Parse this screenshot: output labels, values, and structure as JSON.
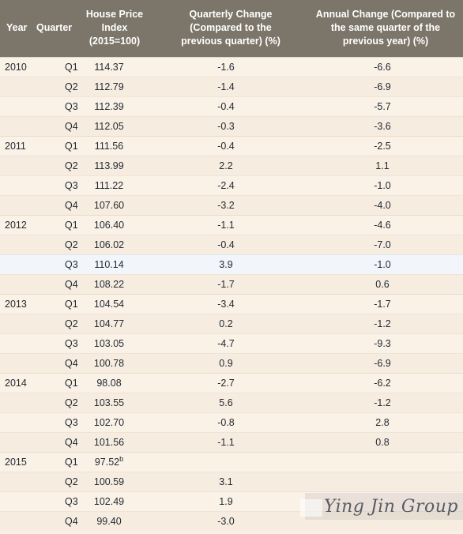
{
  "table": {
    "columns": [
      {
        "key": "year",
        "label": "Year"
      },
      {
        "key": "quarter",
        "label": "Quarter"
      },
      {
        "key": "index",
        "label": "House Price Index (2015=100)",
        "label_lines": [
          "House Price",
          "Index",
          "(2015=100)"
        ]
      },
      {
        "key": "qchg",
        "label": "Quarterly Change (Compared to the previous quarter) (%)",
        "label_lines": [
          "Quarterly Change",
          "(Compared to the",
          "previous quarter) (%)"
        ]
      },
      {
        "key": "achg",
        "label": "Annual Change (Compared to the same quarter of the previous year) (%)",
        "label_lines": [
          "Annual Change (Compared to",
          "the same quarter of the",
          "previous year) (%)"
        ]
      }
    ],
    "rows": [
      {
        "year": "2010",
        "quarter": "Q1",
        "index": "114.37",
        "qchg": "-1.6",
        "achg": "-6.6",
        "year_start": true,
        "highlight": false
      },
      {
        "year": "",
        "quarter": "Q2",
        "index": "112.79",
        "qchg": "-1.4",
        "achg": "-6.9",
        "year_start": false,
        "highlight": false
      },
      {
        "year": "",
        "quarter": "Q3",
        "index": "112.39",
        "qchg": "-0.4",
        "achg": "-5.7",
        "year_start": false,
        "highlight": false
      },
      {
        "year": "",
        "quarter": "Q4",
        "index": "112.05",
        "qchg": "-0.3",
        "achg": "-3.6",
        "year_start": false,
        "highlight": false
      },
      {
        "year": "2011",
        "quarter": "Q1",
        "index": "111.56",
        "qchg": "-0.4",
        "achg": "-2.5",
        "year_start": true,
        "highlight": false
      },
      {
        "year": "",
        "quarter": "Q2",
        "index": "113.99",
        "qchg": "2.2",
        "achg": "1.1",
        "year_start": false,
        "highlight": false
      },
      {
        "year": "",
        "quarter": "Q3",
        "index": "111.22",
        "qchg": "-2.4",
        "achg": "-1.0",
        "year_start": false,
        "highlight": false
      },
      {
        "year": "",
        "quarter": "Q4",
        "index": "107.60",
        "qchg": "-3.2",
        "achg": "-4.0",
        "year_start": false,
        "highlight": false
      },
      {
        "year": "2012",
        "quarter": "Q1",
        "index": "106.40",
        "qchg": "-1.1",
        "achg": "-4.6",
        "year_start": true,
        "highlight": false
      },
      {
        "year": "",
        "quarter": "Q2",
        "index": "106.02",
        "qchg": "-0.4",
        "achg": "-7.0",
        "year_start": false,
        "highlight": false
      },
      {
        "year": "",
        "quarter": "Q3",
        "index": "110.14",
        "qchg": "3.9",
        "achg": "-1.0",
        "year_start": false,
        "highlight": true
      },
      {
        "year": "",
        "quarter": "Q4",
        "index": "108.22",
        "qchg": "-1.7",
        "achg": "0.6",
        "year_start": false,
        "highlight": false
      },
      {
        "year": "2013",
        "quarter": "Q1",
        "index": "104.54",
        "qchg": "-3.4",
        "achg": "-1.7",
        "year_start": true,
        "highlight": false
      },
      {
        "year": "",
        "quarter": "Q2",
        "index": "104.77",
        "qchg": "0.2",
        "achg": "-1.2",
        "year_start": false,
        "highlight": false
      },
      {
        "year": "",
        "quarter": "Q3",
        "index": "103.05",
        "qchg": "-4.7",
        "achg": "-9.3",
        "year_start": false,
        "highlight": false
      },
      {
        "year": "",
        "quarter": "Q4",
        "index": "100.78",
        "qchg": "0.9",
        "achg": "-6.9",
        "year_start": false,
        "highlight": false
      },
      {
        "year": "2014",
        "quarter": "Q1",
        "index": "98.08",
        "qchg": "-2.7",
        "achg": "-6.2",
        "year_start": true,
        "highlight": false
      },
      {
        "year": "",
        "quarter": "Q2",
        "index": "103.55",
        "qchg": "5.6",
        "achg": "-1.2",
        "year_start": false,
        "highlight": false
      },
      {
        "year": "",
        "quarter": "Q3",
        "index": "102.70",
        "qchg": "-0.8",
        "achg": "2.8",
        "year_start": false,
        "highlight": false
      },
      {
        "year": "",
        "quarter": "Q4",
        "index": "101.56",
        "qchg": "-1.1",
        "achg": "0.8",
        "year_start": false,
        "highlight": false
      },
      {
        "year": "2015",
        "quarter": "Q1",
        "index": "97.52",
        "index_footnote": "b",
        "qchg": "",
        "achg": "",
        "year_start": true,
        "highlight": false
      },
      {
        "year": "",
        "quarter": "Q2",
        "index": "100.59",
        "qchg": "3.1",
        "achg": "",
        "year_start": false,
        "highlight": false
      },
      {
        "year": "",
        "quarter": "Q3",
        "index": "102.49",
        "qchg": "1.9",
        "achg": "",
        "year_start": false,
        "highlight": false
      },
      {
        "year": "",
        "quarter": "Q4",
        "index": "99.40",
        "qchg": "-3.0",
        "achg": "",
        "year_start": false,
        "highlight": false
      }
    ]
  },
  "watermark": {
    "text": "Ying Jin Group"
  },
  "colors": {
    "header_background": "#7b7669",
    "header_text": "#ffffff",
    "row_background": "#faf1e7",
    "row_background_alt": "#f7ece0",
    "row_highlight": "#f2f5f9",
    "body_text": "#222b33",
    "row_divider": "#efe4d6"
  }
}
